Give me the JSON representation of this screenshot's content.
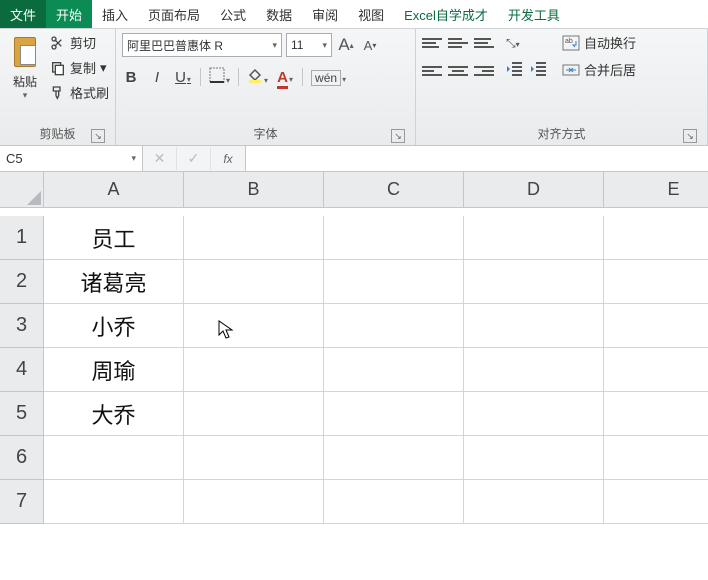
{
  "menu": {
    "file": "文件",
    "home": "开始",
    "insert": "插入",
    "layout": "页面布局",
    "formula": "公式",
    "data": "数据",
    "review": "审阅",
    "view": "视图",
    "excel_self": "Excel自学成才",
    "dev": "开发工具"
  },
  "clipboard": {
    "paste": "粘贴",
    "cut": "剪切",
    "copy": "复制",
    "format_painter": "格式刷",
    "group_label": "剪贴板"
  },
  "font": {
    "name": "阿里巴巴普惠体 R",
    "size": "11",
    "inc": "A",
    "dec": "A",
    "bold": "B",
    "italic": "I",
    "underline": "U",
    "wen": "wén",
    "group_label": "字体"
  },
  "align": {
    "wrap": "自动换行",
    "merge": "合并后居",
    "group_label": "对齐方式"
  },
  "fbar": {
    "namebox": "C5",
    "cancel": "✕",
    "confirm": "✓",
    "fx": "fx",
    "value": ""
  },
  "columns": [
    "A",
    "B",
    "C",
    "D",
    "E"
  ],
  "rows": [
    "1",
    "2",
    "3",
    "4",
    "5",
    "6",
    "7"
  ],
  "cells": {
    "A1": "员工",
    "A2": "诸葛亮",
    "A3": "小乔",
    "A4": "周瑜",
    "A5": "大乔"
  }
}
